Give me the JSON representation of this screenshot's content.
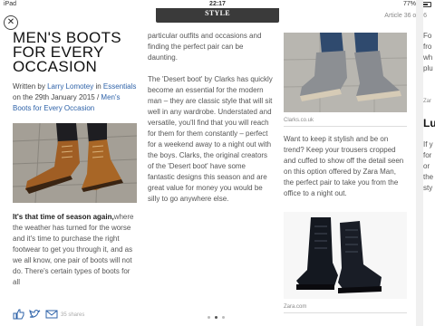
{
  "status": {
    "device": "iPad",
    "time": "22:17",
    "battery": "77%",
    "battery_level": 0.77
  },
  "header": {
    "brand_small": "",
    "brand": "STYLE",
    "article_count": "Article 36 of 36"
  },
  "article": {
    "title": "MEN'S BOOTS FOR EVERY OCCASION",
    "byline_prefix": "Written by ",
    "author": "Larry Lomotey",
    "in_word": " in ",
    "category": "Essentials",
    "date_text": " on the 29th January 2015 / ",
    "tag": "Men's Boots for Every Occasion",
    "lead_bold": "It's that time of season again,",
    "lead_rest": "where the weather has turned for the worse and it's time to purchase the right footwear to get you through it, and as we all know, one pair of boots will not do. There's certain types of boots for all",
    "col2_p1": "particular outfits and occasions and finding the perfect pair can be daunting.",
    "col2_p2": "The 'Desert boot' by Clarks has quickly become an essential for the modern man – they are classic style that will sit well in any wardrobe. Understated and versatile, you'll find that you will reach for them for them constantly – perfect for a weekend away to a night out with the boys. Clarks, the original creators of the 'Desert boot' have some fantastic designs this season and are great value for money you would be silly to go anywhere else.",
    "caption1": "Clarks.co.uk",
    "col3_p1": "Want to keep it stylish and be on trend? Keep your trousers cropped and cuffed to show off the detail seen on this option offered by Zara Man, the perfect pair to take you from the office to a night out.",
    "caption2": "Zara.com",
    "col4_lines": [
      "Fo",
      "fro",
      "wh",
      "plu",
      "",
      "",
      "Zar",
      "",
      "Lu",
      "",
      "If y",
      "for",
      "or",
      "the",
      "sty"
    ]
  },
  "footer": {
    "shares": "35 shares",
    "share_icons": [
      "like-icon",
      "twitter-icon",
      "email-icon"
    ]
  },
  "colors": {
    "link": "#2f63a9",
    "brand_bar": "#3a3a3a"
  }
}
